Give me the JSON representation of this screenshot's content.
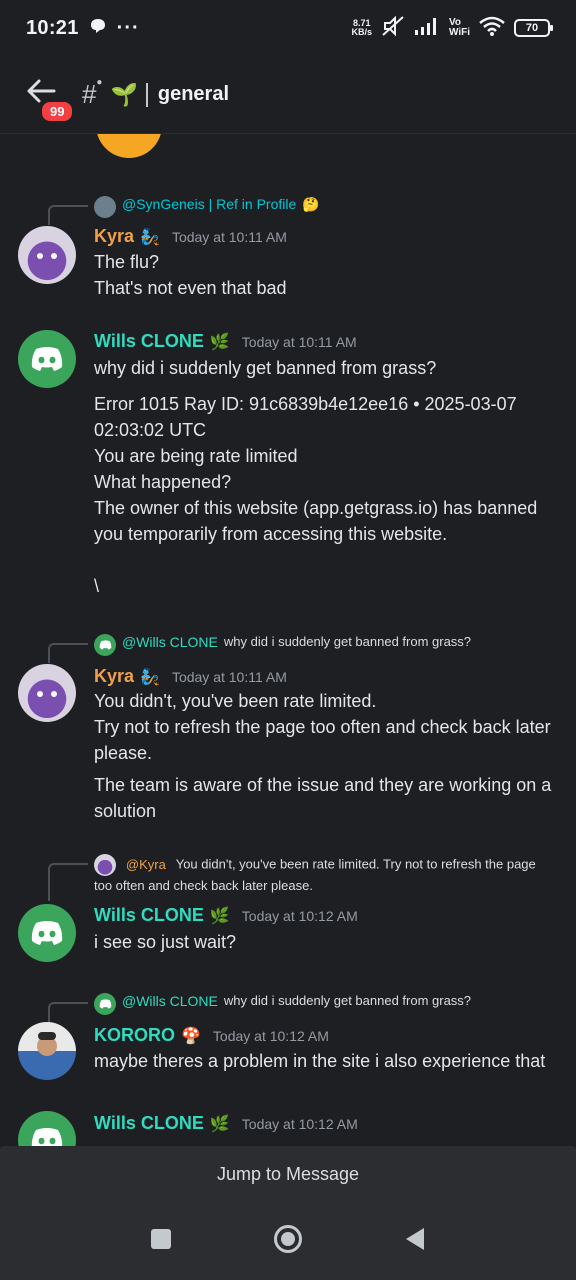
{
  "status": {
    "time": "10:21",
    "netspeed_value": "8.71",
    "netspeed_unit": "KB/s",
    "vo": "Vo",
    "wifi_label": "WiFi",
    "battery": "70"
  },
  "header": {
    "badge": "99",
    "channel": "general"
  },
  "messages": [
    {
      "reply": {
        "name": "@SynGeneis | Ref in Profile",
        "emoji": "🤔"
      },
      "author": "Kyra",
      "tag": "🧞",
      "time": "Today at 10:11 AM",
      "lines": [
        "The flu?",
        "That's not even that bad"
      ]
    },
    {
      "author": "Wills CLONE",
      "tag": "🌿",
      "time": "Today at 10:11 AM",
      "lines": [
        "why did i suddenly get banned from grass?",
        "Error 1015 Ray ID: 91c6839b4e12ee16 • 2025-03-07 02:03:02 UTC",
        "You are being rate limited",
        "What happened?",
        "The owner of this website (app.getgrass.io) has banned you temporarily from accessing this website.",
        "\\"
      ]
    },
    {
      "reply": {
        "name": "@Wills CLONE",
        "text": "why did i suddenly get banned from grass?"
      },
      "author": "Kyra",
      "tag": "🧞",
      "time": "Today at 10:11 AM",
      "lines": [
        "You didn't, you've been rate limited.",
        "Try not to refresh the page too often and check back later please.",
        "The team is aware of the issue and they are working on a solution"
      ]
    },
    {
      "reply": {
        "name": "@Kyra",
        "text": "You didn't, you've been rate limited.  Try not to refresh the page too often and check back later please."
      },
      "author": "Wills CLONE",
      "tag": "🌿",
      "time": "Today at 10:12 AM",
      "lines": [
        "i see so just wait?"
      ]
    },
    {
      "reply": {
        "name": "@Wills CLONE",
        "text": "why did i suddenly get banned from grass?"
      },
      "author": "KORORO",
      "tag": "🍄",
      "time": "Today at 10:12 AM",
      "lines": [
        "maybe theres a problem in the site i also experience that"
      ]
    },
    {
      "author": "Wills CLONE",
      "tag": "🌿",
      "time": "Today at 10:12 AM",
      "lines": []
    }
  ],
  "jump": {
    "label": "Jump to Message"
  }
}
